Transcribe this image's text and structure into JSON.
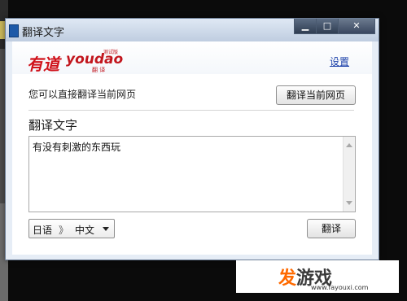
{
  "window": {
    "title": "翻译文字",
    "buttons": {
      "minimize": "▁",
      "maximize": "□",
      "close": "✕"
    }
  },
  "brand": {
    "logo_cn": "有道",
    "logo_en": "youdao",
    "logo_sub": "翻 译",
    "logo_tag": "测试版"
  },
  "header": {
    "settings_label": "设置"
  },
  "main": {
    "hint": "您可以直接翻译当前网页",
    "translate_page_button": "翻译当前网页",
    "section_title": "翻译文字",
    "input_text": "有没有刺激的东西玩",
    "lang_from": "日语",
    "lang_arrow": "》",
    "lang_to": "中文",
    "translate_button": "翻译"
  },
  "watermark": {
    "main_accent": "发",
    "main_rest": "游戏",
    "url": "www.fayouxi.com"
  },
  "colors": {
    "brand_red": "#d0121b",
    "link_blue": "#1a3faa",
    "watermark_orange": "#ff6a00"
  }
}
